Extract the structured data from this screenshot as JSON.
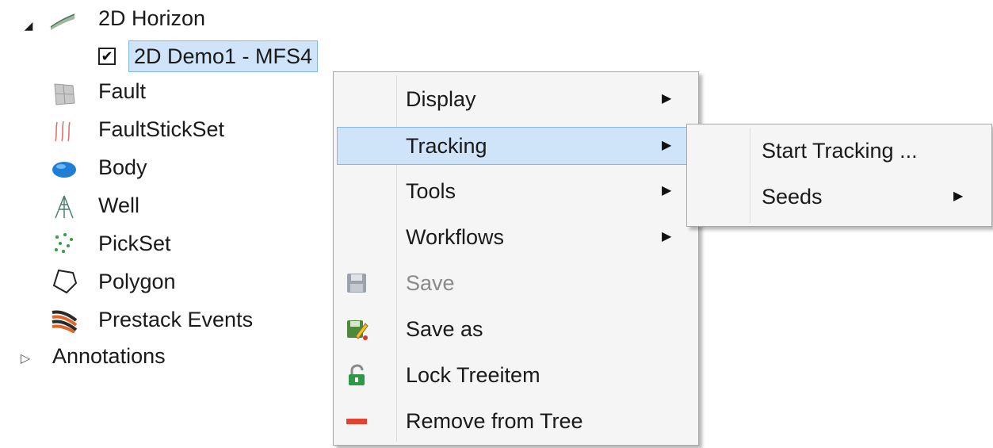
{
  "tree": {
    "horizon": {
      "label": "2D Horizon",
      "expander": "◢"
    },
    "selected_item": {
      "label": "2D Demo1 - MFS4",
      "checked": "✔"
    },
    "items": [
      {
        "label": "Fault"
      },
      {
        "label": "FaultStickSet"
      },
      {
        "label": "Body"
      },
      {
        "label": "Well"
      },
      {
        "label": "PickSet"
      },
      {
        "label": "Polygon"
      },
      {
        "label": "Prestack Events"
      }
    ],
    "annotations": {
      "label": "Annotations",
      "expander": "▷"
    }
  },
  "context_menu": {
    "items": [
      {
        "label": "Display",
        "arrow": "▶"
      },
      {
        "label": "Tracking",
        "arrow": "▶"
      },
      {
        "label": "Tools",
        "arrow": "▶"
      },
      {
        "label": "Workflows",
        "arrow": "▶"
      },
      {
        "label": "Save",
        "icon": "save-icon"
      },
      {
        "label": "Save as",
        "icon": "save-as-icon"
      },
      {
        "label": "Lock Treeitem",
        "icon": "lock-icon"
      },
      {
        "label": "Remove from Tree",
        "icon": "remove-icon"
      }
    ]
  },
  "submenu": {
    "items": [
      {
        "label": "Start Tracking ..."
      },
      {
        "label": "Seeds",
        "arrow": "▶"
      }
    ]
  },
  "colors": {
    "selection_bg": "#cfe4f9",
    "selection_border": "#86b6e6",
    "menu_bg": "#f5f5f5",
    "disabled_text": "#8a8a8a"
  }
}
